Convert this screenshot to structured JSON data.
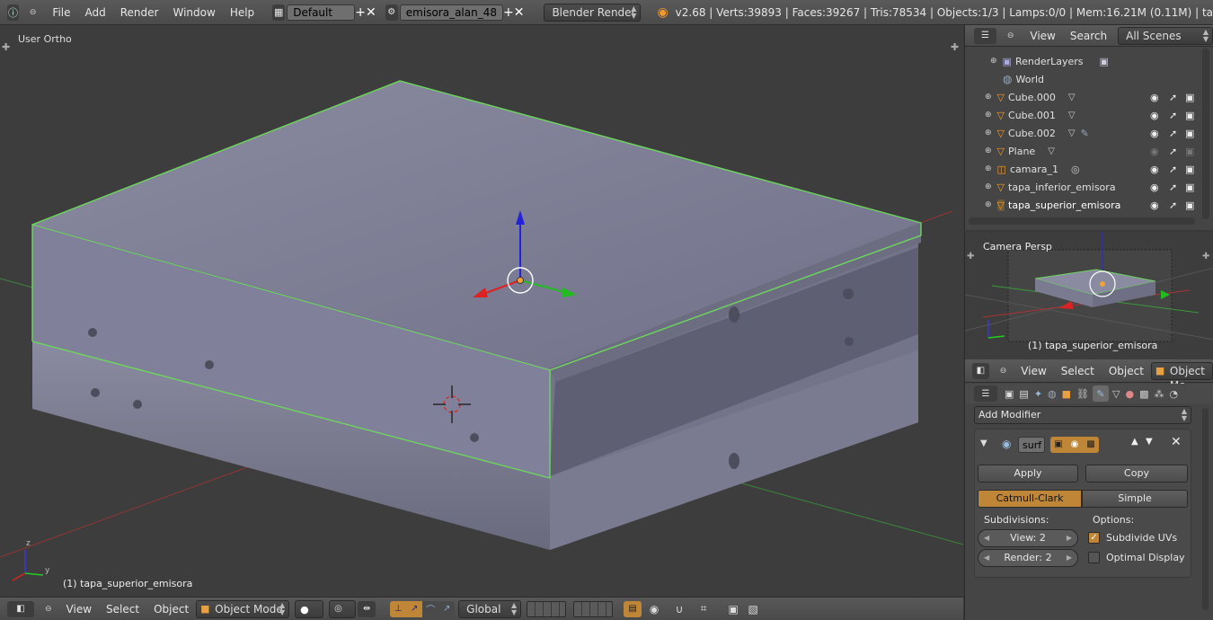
{
  "topbar": {
    "menus": [
      "File",
      "Add",
      "Render",
      "Window",
      "Help"
    ],
    "layout": "Default",
    "scene": "emisora_alan_48",
    "engine": "Blender Render",
    "stats": "v2.68 | Verts:39893 | Faces:39267 | Tris:78534 | Objects:1/3 | Lamps:0/0 | Mem:16.21M (0.11M) | ta"
  },
  "viewport": {
    "view_label": "User Ortho",
    "object_label": "(1) tapa_superior_emisora",
    "axis_z": "z",
    "axis_y": "y"
  },
  "bottombar": {
    "menus": [
      "View",
      "Select",
      "Object"
    ],
    "mode": "Object Mode",
    "orientation": "Global"
  },
  "outliner": {
    "view_menu": "View",
    "search_menu": "Search",
    "filter": "All Scenes",
    "items": [
      {
        "name": "RenderLayers",
        "type": "renderlayers"
      },
      {
        "name": "World",
        "type": "world"
      },
      {
        "name": "Cube.000",
        "type": "mesh"
      },
      {
        "name": "Cube.001",
        "type": "mesh"
      },
      {
        "name": "Cube.002",
        "type": "mesh"
      },
      {
        "name": "Plane",
        "type": "mesh"
      },
      {
        "name": "camara_1",
        "type": "camera"
      },
      {
        "name": "tapa_inferior_emisora",
        "type": "mesh"
      },
      {
        "name": "tapa_superior_emisora",
        "type": "mesh"
      }
    ]
  },
  "camera_view": {
    "label": "Camera Persp",
    "object_label": "(1) tapa_superior_emisora"
  },
  "props_header": {
    "menus": [
      "View",
      "Select",
      "Object"
    ],
    "mode": "Object Mo"
  },
  "modifier": {
    "add_label": "Add Modifier",
    "name": "surf",
    "apply": "Apply",
    "copy": "Copy",
    "tab_catmull": "Catmull-Clark",
    "tab_simple": "Simple",
    "subdivisions_label": "Subdivisions:",
    "options_label": "Options:",
    "view_value": "View: 2",
    "render_value": "Render: 2",
    "subdivide_uvs": "Subdivide UVs",
    "subdivide_uvs_checked": true,
    "optimal_display": "Optimal Display",
    "optimal_display_checked": false
  },
  "colors": {
    "active_tab": "#c08638",
    "selection_outline": "#6cd75c",
    "axis_x": "#d22",
    "axis_y": "#2c2",
    "axis_z": "#22e"
  }
}
